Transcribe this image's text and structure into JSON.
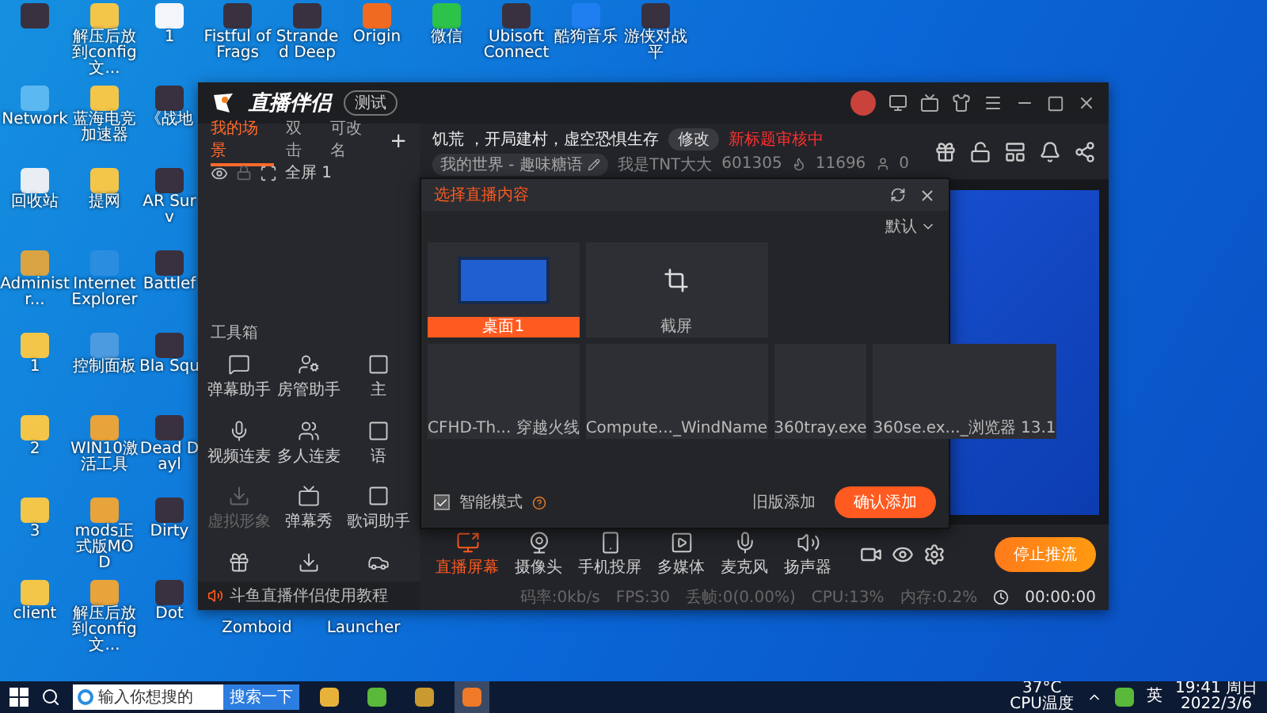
{
  "desktop": {
    "columns": [
      [
        {
          "kind": "game"
        },
        {
          "label": "Network",
          "kind": "network"
        },
        {
          "label": "回收站",
          "kind": "recycle"
        },
        {
          "label": "Administr...",
          "kind": "user"
        },
        {
          "label": "1",
          "kind": "folder"
        },
        {
          "label": "2",
          "kind": "folder"
        },
        {
          "label": "3",
          "kind": "folder"
        },
        {
          "label": "client",
          "kind": "folder"
        }
      ],
      [
        {
          "label": "解压后放到config文...",
          "kind": "folder"
        },
        {
          "label": "蓝海电竞加速器",
          "kind": "folder"
        },
        {
          "label": "提网",
          "kind": "folder"
        },
        {
          "label": "Internet Explorer",
          "kind": "browser"
        },
        {
          "label": "控制面板",
          "kind": "control"
        },
        {
          "label": "WIN10激活工具",
          "kind": "zip"
        },
        {
          "label": "mods正式版MOD",
          "kind": "zip"
        },
        {
          "label": "解压后放到config文...",
          "kind": "zip"
        }
      ],
      [
        {
          "label": "1",
          "kind": "doc"
        },
        {
          "label": "《战地",
          "kind": "game"
        },
        {
          "label": "AR Surv",
          "kind": "game"
        },
        {
          "label": "Battlef",
          "kind": "game"
        },
        {
          "label": "Bla Squ",
          "kind": "game"
        },
        {
          "label": "Dead Dayl",
          "kind": "game"
        },
        {
          "label": "Dirty",
          "kind": "game"
        },
        {
          "label": "Dot",
          "kind": "game"
        }
      ]
    ],
    "top_row": [
      {
        "label": "Fistful of Frags",
        "kind": "game"
      },
      {
        "label": "Stranded Deep",
        "kind": "game"
      },
      {
        "label": "Origin",
        "kind": "origin"
      },
      {
        "label": "微信",
        "kind": "chat"
      },
      {
        "label": "Ubisoft Connect",
        "kind": "game"
      },
      {
        "label": "酷狗音乐",
        "kind": "music"
      },
      {
        "label": "游侠对战平",
        "kind": "game"
      }
    ],
    "hidden_labels": [
      "Zomboid",
      "Launcher"
    ]
  },
  "app": {
    "title": "直播伴侣",
    "badge": "测试",
    "scene_tabs": [
      {
        "label": "我的场景",
        "selected": true
      },
      {
        "label": "双击",
        "selected": false
      },
      {
        "label": "可改名",
        "selected": false
      }
    ],
    "add_tab": "+",
    "scenes": [
      {
        "label": "全屏 1",
        "visible": true
      }
    ],
    "toolbox": {
      "title": "工具箱",
      "tools": [
        {
          "label": "弹幕助手",
          "kind": "chat",
          "disabled": false
        },
        {
          "label": "房管助手",
          "kind": "user",
          "disabled": false
        },
        {
          "label": "主",
          "kind": "frame",
          "disabled": false
        },
        {
          "label": "视频连麦",
          "kind": "mic",
          "disabled": false
        },
        {
          "label": "多人连麦",
          "kind": "users",
          "disabled": false
        },
        {
          "label": "语",
          "kind": "frame",
          "disabled": false
        },
        {
          "label": "虚拟形象",
          "kind": "download",
          "disabled": true
        },
        {
          "label": "弹幕秀",
          "kind": "tv",
          "disabled": false
        },
        {
          "label": "歌词助手",
          "kind": "frame",
          "disabled": false
        },
        {
          "kind": "pk",
          "disabled": false
        },
        {
          "kind": "download",
          "disabled": false
        },
        {
          "kind": "car",
          "disabled": false
        }
      ]
    },
    "tutorial": "斗鱼直播伴侣使用教程",
    "stream": {
      "title": "饥荒 ，开局建村，虚空恐惧生存",
      "edit": "修改",
      "review": "新标题审核中",
      "category": "我的世界 - 趣味糖语",
      "streamer": "我是TNT大大",
      "room": "601305",
      "popularity": "11696",
      "viewers": "0"
    },
    "dialog": {
      "title": "选择直播内容",
      "sort": "默认",
      "sources": [
        {
          "label": "桌面1",
          "kind": "screen",
          "selected": true
        },
        {
          "label": "截屏",
          "kind": "crop",
          "selected": false
        },
        {
          "label": "CFHD-Th...  穿越火线",
          "kind": "window",
          "selected": false
        },
        {
          "label": "Compute..._WindName",
          "kind": "window",
          "selected": false
        },
        {
          "label": "360tray.exe",
          "kind": "window",
          "selected": false
        },
        {
          "label": "360se.ex..._浏览器 13.1",
          "kind": "window",
          "selected": false
        }
      ],
      "smart_mode": {
        "label": "智能模式",
        "checked": true
      },
      "legacy": "旧版添加",
      "confirm": "确认添加"
    },
    "toolbar": {
      "sources": [
        {
          "label": "直播屏幕",
          "kind": "screen",
          "selected": true
        },
        {
          "label": "摄像头",
          "kind": "webcam",
          "selected": false
        },
        {
          "label": "手机投屏",
          "kind": "phone",
          "selected": false
        },
        {
          "label": "多媒体",
          "kind": "media",
          "selected": false
        },
        {
          "label": "麦克风",
          "kind": "mic",
          "selected": false
        },
        {
          "label": "扬声器",
          "kind": "speaker",
          "selected": false
        }
      ],
      "stop": "停止推流"
    },
    "status": [
      "码率:0kb/s",
      "FPS:30",
      "丢帧:0(0.00%)",
      "CPU:13%",
      "内存:0.2%"
    ],
    "timer": "00:00:00"
  },
  "taskbar": {
    "search_placeholder": "输入你想搜的",
    "search_button": "搜索一下",
    "apps": [
      {
        "kind": "files",
        "selected": false
      },
      {
        "kind": "green",
        "selected": false
      },
      {
        "kind": "game",
        "selected": false
      },
      {
        "kind": "stream",
        "selected": true
      }
    ],
    "temp": "37°C",
    "temp_label": "CPU温度",
    "ime": "英",
    "time": "19:41 周日",
    "date": "2022/3/6"
  }
}
